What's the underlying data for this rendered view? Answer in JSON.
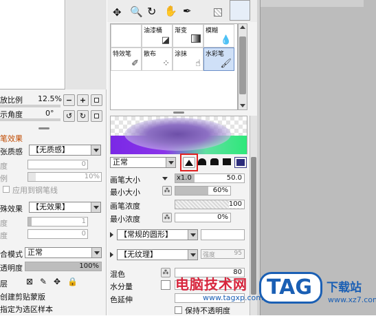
{
  "left": {
    "zoom_label": "放比例",
    "zoom_value": "12.5%",
    "angle_label": "示角度",
    "angle_value": "0°",
    "effects_header": "笔效果",
    "paper_label": "张质感",
    "paper_value": "【无质感】",
    "paper_strength_label": "度",
    "paper_strength_value": "0",
    "paper_scale_label": "例",
    "paper_scale_value": "10%",
    "apply_pen_label": "应用到钢笔线",
    "special_label": "殊效果",
    "special_value": "【无效果】",
    "special_strength_label": "度",
    "special_strength_value": "1",
    "special_width_label": "度",
    "special_width_value": "0",
    "blend_label": "合模式",
    "blend_value": "正常",
    "opacity_label": "透明度",
    "opacity_value": "100%",
    "layer_label": "层",
    "clip_label": "创建剪贴蒙版",
    "sample_label": "指定为选区样本"
  },
  "tools": {
    "cells": [
      {
        "label": "",
        "icon": "empty"
      },
      {
        "label": "油漆桶",
        "icon": "bucket-icon"
      },
      {
        "label": "渐变",
        "icon": "gradient-icon"
      },
      {
        "label": "模糊",
        "icon": "droplet-icon"
      },
      {
        "label": "特效笔",
        "icon": "sparkle-pen-icon"
      },
      {
        "label": "散布",
        "icon": "scatter-icon"
      },
      {
        "label": "涂抹",
        "icon": "smudge-icon"
      },
      {
        "label": "水彩笔",
        "icon": "watercolor-brush-icon"
      }
    ]
  },
  "brush": {
    "blend_mode": "正常",
    "size_label": "画笔大小",
    "size_multiplier": "x1.0",
    "size_value": "50.0",
    "min_size_label": "最小大小",
    "min_size_value": "60%",
    "density_label": "画笔浓度",
    "density_value": "100",
    "min_density_label": "最小浓度",
    "min_density_value": "0%",
    "shape_value": "【常规的圆形】",
    "texture_value": "【无纹理】",
    "texture_strength": "强度",
    "texture_strength_value": "95",
    "mix_label": "混色",
    "mix_value": "80",
    "water_label": "水分量",
    "color_extend_label": "色延伸",
    "keep_opacity_label": "保持不透明度"
  },
  "watermark": {
    "site_cn": "电脑技术网",
    "site_url": "www.tagxp.com",
    "tag": "TAG",
    "download_cn": "下载站",
    "download_url": "www.xz7.com"
  },
  "colors": {
    "accent_highlight": "#e02020",
    "tag_blue": "#1a5fb4",
    "watermark_red": "#d7263d"
  }
}
